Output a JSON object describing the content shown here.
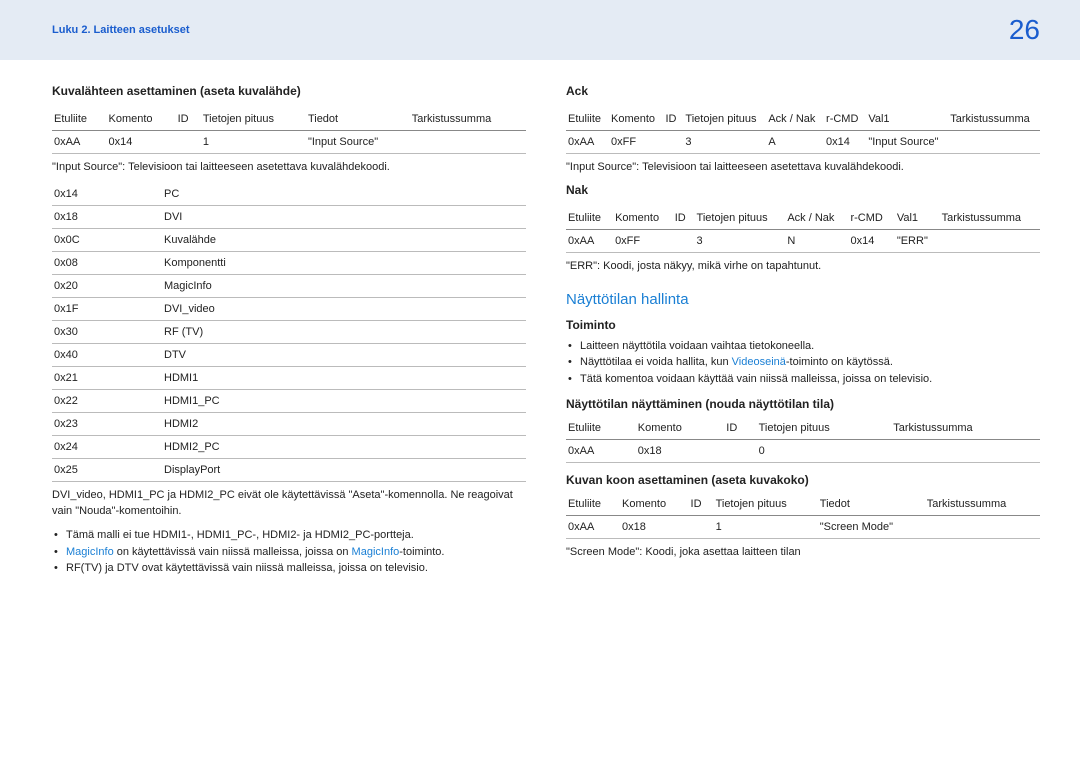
{
  "header": {
    "chapter": "Luku 2. Laitteen asetukset",
    "page": "26"
  },
  "left": {
    "title": "Kuvalähteen asettaminen (aseta kuvalähde)",
    "t1_headers": [
      "Etuliite",
      "Komento",
      "ID",
      "Tietojen pituus",
      "Tiedot",
      "Tarkistussumma"
    ],
    "t1_row": [
      "0xAA",
      "0x14",
      "",
      "1",
      "\"Input Source\"",
      ""
    ],
    "note1": "\"Input Source\": Televisioon tai laitteeseen asetettava kuvalähdekoodi.",
    "codes": [
      [
        "0x14",
        "PC"
      ],
      [
        "0x18",
        "DVI"
      ],
      [
        "0x0C",
        "Kuvalähde"
      ],
      [
        "0x08",
        "Komponentti"
      ],
      [
        "0x20",
        "MagicInfo"
      ],
      [
        "0x1F",
        "DVI_video"
      ],
      [
        "0x30",
        "RF (TV)"
      ],
      [
        "0x40",
        "DTV"
      ],
      [
        "0x21",
        "HDMI1"
      ],
      [
        "0x22",
        "HDMI1_PC"
      ],
      [
        "0x23",
        "HDMI2"
      ],
      [
        "0x24",
        "HDMI2_PC"
      ],
      [
        "0x25",
        "DisplayPort"
      ]
    ],
    "note2": "DVI_video, HDMI1_PC ja HDMI2_PC eivät ole käytettävissä \"Aseta\"-komennolla. Ne reagoivat vain \"Nouda\"-komentoihin.",
    "bullets": {
      "b1": "Tämä malli ei tue HDMI1-, HDMI1_PC-, HDMI2- ja HDMI2_PC-portteja.",
      "b2a": "MagicInfo",
      "b2b": " on käytettävissä vain niissä malleissa, joissa on ",
      "b2c": "MagicInfo",
      "b2d": "-toiminto.",
      "b3": "RF(TV) ja DTV ovat käytettävissä vain niissä malleissa, joissa on televisio."
    }
  },
  "right": {
    "ack_title": "Ack",
    "ack_headers": [
      "Etuliite",
      "Komento",
      "ID",
      "Tietojen pituus",
      "Ack / Nak",
      "r-CMD",
      "Val1",
      "Tarkistussumma"
    ],
    "ack_row": [
      "0xAA",
      "0xFF",
      "",
      "3",
      "A",
      "0x14",
      "\"Input Source\"",
      ""
    ],
    "ack_note": "\"Input Source\": Televisioon tai laitteeseen asetettava kuvalähdekoodi.",
    "nak_title": "Nak",
    "nak_headers": [
      "Etuliite",
      "Komento",
      "ID",
      "Tietojen pituus",
      "Ack / Nak",
      "r-CMD",
      "Val1",
      "Tarkistussumma"
    ],
    "nak_row": [
      "0xAA",
      "0xFF",
      "",
      "3",
      "N",
      "0x14",
      "\"ERR\"",
      ""
    ],
    "nak_note": "\"ERR\": Koodi, josta näkyy, mikä virhe on tapahtunut.",
    "blue_heading": "Näyttötilan hallinta",
    "toiminto": "Toiminto",
    "toiminto_bullets": {
      "b1": "Laitteen näyttötila voidaan vaihtaa tietokoneella.",
      "b2a": "Näyttötilaa ei voida hallita, kun ",
      "b2b": "Videoseinä",
      "b2c": "-toiminto on käytössä.",
      "b3": "Tätä komentoa voidaan käyttää vain niissä malleissa, joissa on televisio."
    },
    "disp_title": "Näyttötilan näyttäminen (nouda näyttötilan tila)",
    "disp_headers": [
      "Etuliite",
      "Komento",
      "ID",
      "Tietojen pituus",
      "Tarkistussumma"
    ],
    "disp_row": [
      "0xAA",
      "0x18",
      "",
      "0",
      ""
    ],
    "size_title": "Kuvan koon asettaminen (aseta kuvakoko)",
    "size_headers": [
      "Etuliite",
      "Komento",
      "ID",
      "Tietojen pituus",
      "Tiedot",
      "Tarkistussumma"
    ],
    "size_row": [
      "0xAA",
      "0x18",
      "",
      "1",
      "\"Screen Mode\"",
      ""
    ],
    "size_note": "\"Screen Mode\": Koodi, joka asettaa laitteen tilan"
  }
}
